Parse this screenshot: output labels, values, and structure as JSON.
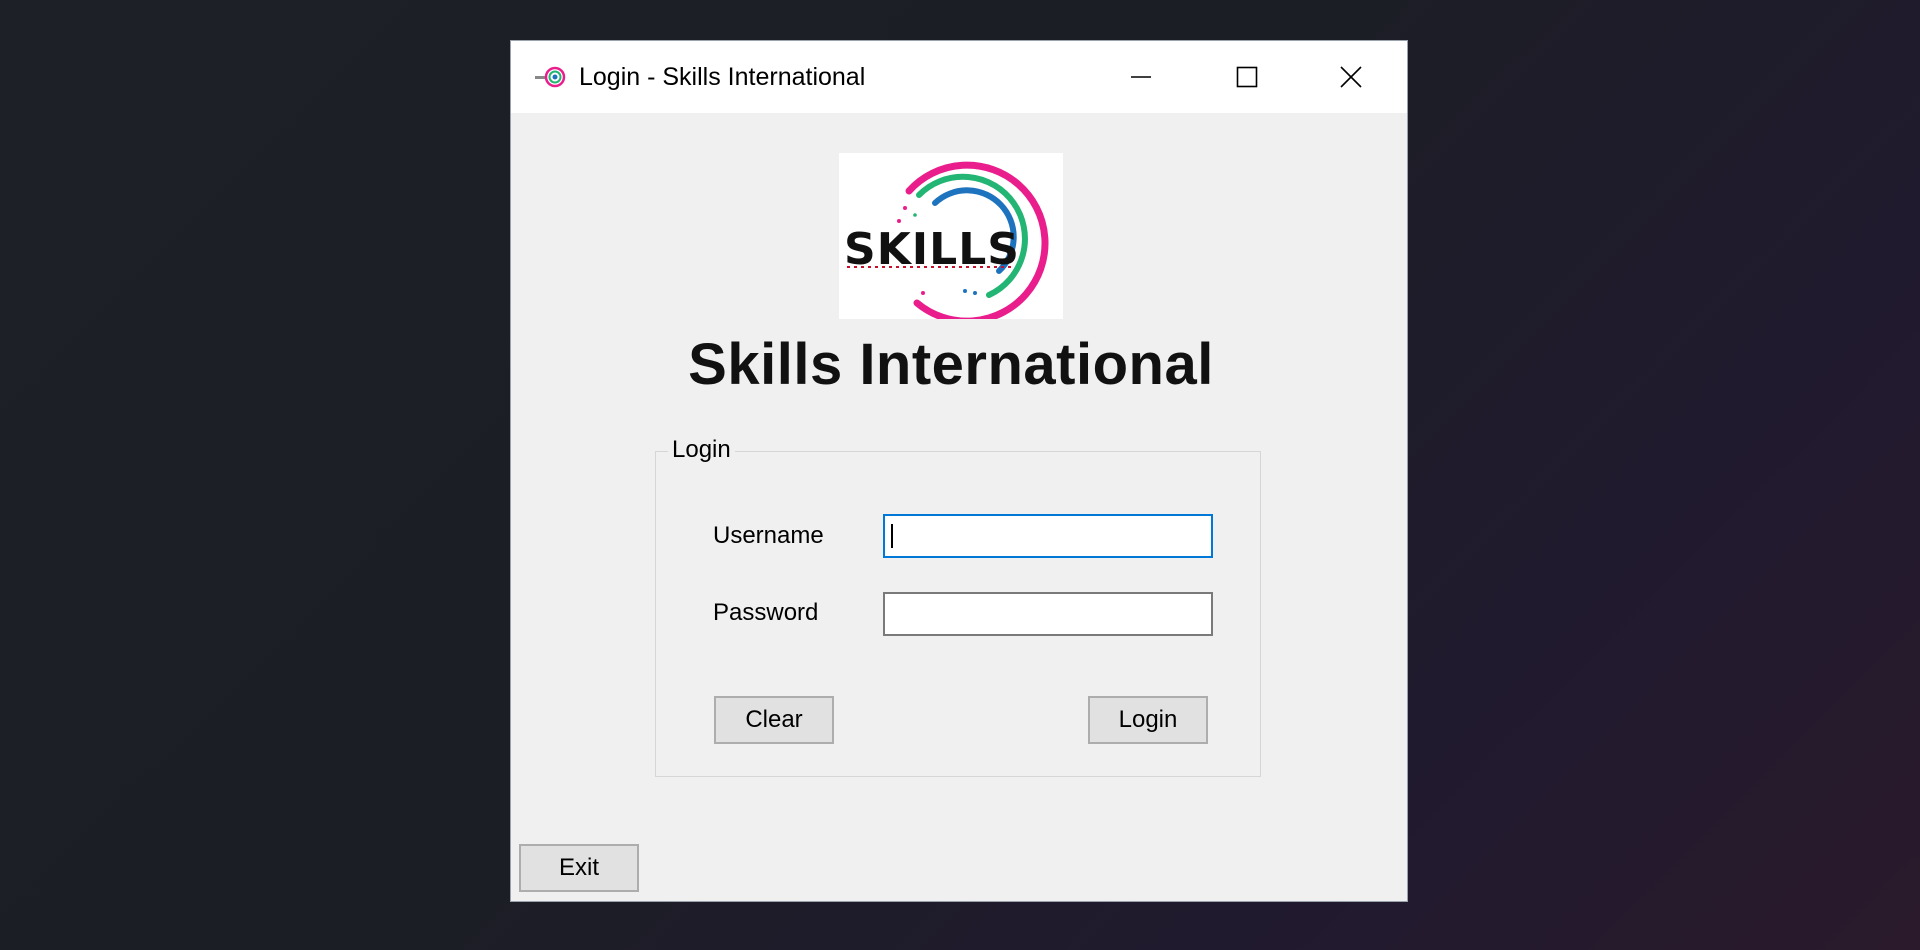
{
  "window": {
    "title": "Login - Skills International",
    "controls": {
      "minimize_icon": "minimize-icon",
      "maximize_icon": "maximize-icon",
      "close_icon": "close-icon"
    }
  },
  "logo": {
    "text": "SKILLS",
    "colors": {
      "outer_ring": "#e91e8c",
      "middle_ring": "#22b573",
      "inner_ring": "#1e73be",
      "text": "#111111"
    }
  },
  "brand": {
    "title": "Skills International"
  },
  "login_group": {
    "legend": "Login",
    "username_label": "Username",
    "username_value": "",
    "password_label": "Password",
    "password_value": "",
    "clear_label": "Clear",
    "login_label": "Login"
  },
  "footer": {
    "exit_label": "Exit"
  },
  "theme": {
    "accent": "#0078d7",
    "window_bg": "#f0f0f0",
    "button_bg": "#e1e1e1"
  }
}
